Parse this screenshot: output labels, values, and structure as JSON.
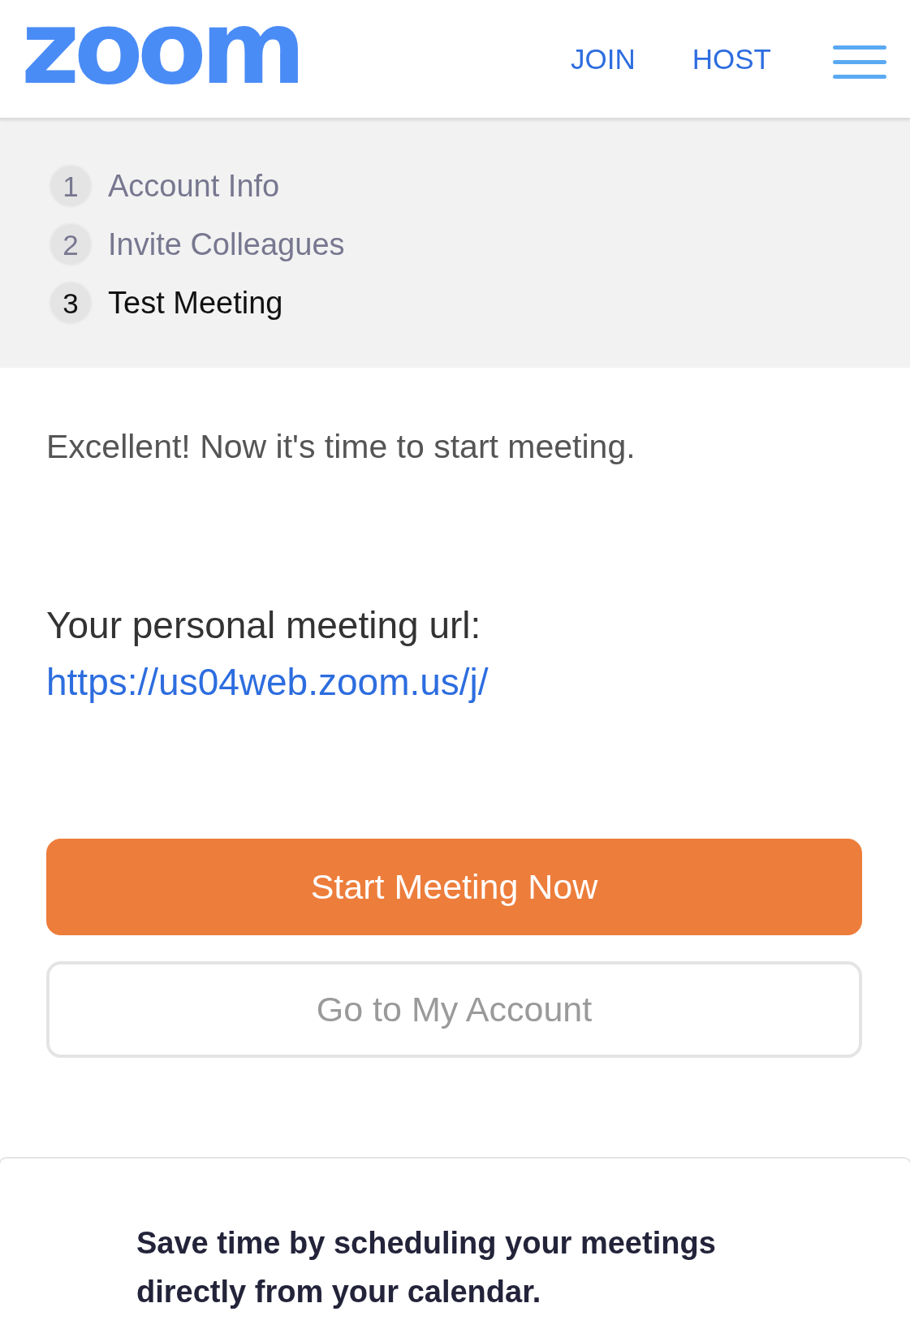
{
  "header": {
    "logo": "zoom",
    "nav_links": [
      "JOIN",
      "HOST"
    ]
  },
  "steps": [
    {
      "number": "1",
      "label": "Account Info",
      "active": false
    },
    {
      "number": "2",
      "label": "Invite Colleagues",
      "active": false
    },
    {
      "number": "3",
      "label": "Test Meeting",
      "active": true
    }
  ],
  "message": "Excellent! Now it's time to start meeting.",
  "meeting_url": {
    "label": "Your personal meeting url:",
    "url": "https://us04web.zoom.us/j/"
  },
  "buttons": [
    {
      "label": "Start Meeting Now",
      "kind": "primary"
    },
    {
      "label": "Go to My Account",
      "kind": "secondary"
    }
  ],
  "promo": {
    "text": "Save time by scheduling your meetings directly from your calendar."
  }
}
